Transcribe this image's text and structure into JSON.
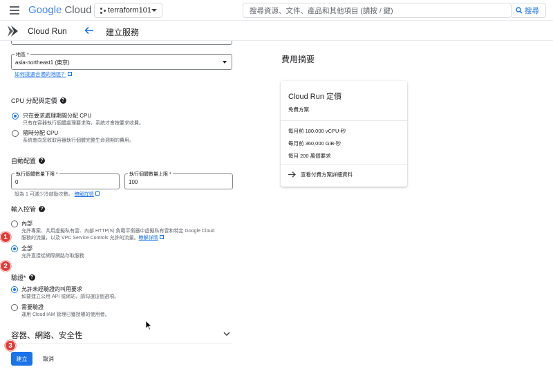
{
  "topbar": {
    "logo_google": "Google",
    "logo_cloud": "Cloud",
    "project": "terraform101",
    "search_placeholder": "搜尋資源、文件、產品和其他項目 (請按 / 鍵)",
    "search_button": "搜尋"
  },
  "subheader": {
    "product": "Cloud Run",
    "page_title": "建立服務"
  },
  "region": {
    "label": "地區 *",
    "value": "asia-northeast1 (東京)",
    "help_link": "如何挑選合適的地區？"
  },
  "cpu": {
    "title": "CPU 分配與定價",
    "options": [
      {
        "label": "只在要求處理期間分配 CPU",
        "desc": "只有在容器執行個體處理要求時，系統才會按要求收費。",
        "selected": true
      },
      {
        "label": "隨時分配 CPU",
        "desc": "系統會向您收取容器執行個體完整生命週期的費用。",
        "selected": false
      }
    ]
  },
  "autoscale": {
    "title": "自動配置",
    "min_label": "執行個體數量下限 *",
    "min_value": "0",
    "max_label": "執行個體數量上限 *",
    "max_value": "100",
    "hint": "設為 1 可減少冷啟動次數。",
    "hint_link": "瞭解詳情"
  },
  "ingress": {
    "title": "輸入控管",
    "options": [
      {
        "label": "內部",
        "desc1": "允許專案、共用虛擬私有雲、內部 HTTP(S) 負載平衡器中虛擬私有雲和特定 Google Cloud",
        "desc2": "服務的流量，以及 VPC Service Controls 允許的流量。",
        "link": "瞭解詳情",
        "selected": false
      },
      {
        "label": "全部",
        "desc1": "允許直接從網際網路存取服務",
        "selected": true
      }
    ]
  },
  "auth": {
    "title": "驗證*",
    "options": [
      {
        "label": "允許未經驗證的叫用要求",
        "desc": "如要建立公用 API 或網站，請勾選這個選項。",
        "selected": true
      },
      {
        "label": "需要驗證",
        "desc": "運用 Cloud IAM 管理已獲授權的使用者。",
        "selected": false
      }
    ]
  },
  "advanced": {
    "title": "容器、網路、安全性"
  },
  "actions": {
    "create": "建立",
    "cancel": "取消"
  },
  "badges": [
    "1",
    "2",
    "3"
  ],
  "cost": {
    "title": "費用摘要",
    "card_title": "Cloud Run 定價",
    "tier": "免費方案",
    "lines": [
      "每月前 180,000 vCPU-秒",
      "每月前 360,000 GiB-秒",
      "每月 200 萬個要求"
    ],
    "link": "查看付費方案詳細資料"
  },
  "colors": {
    "accent": "#1a73e8",
    "badge": "#e53935"
  }
}
